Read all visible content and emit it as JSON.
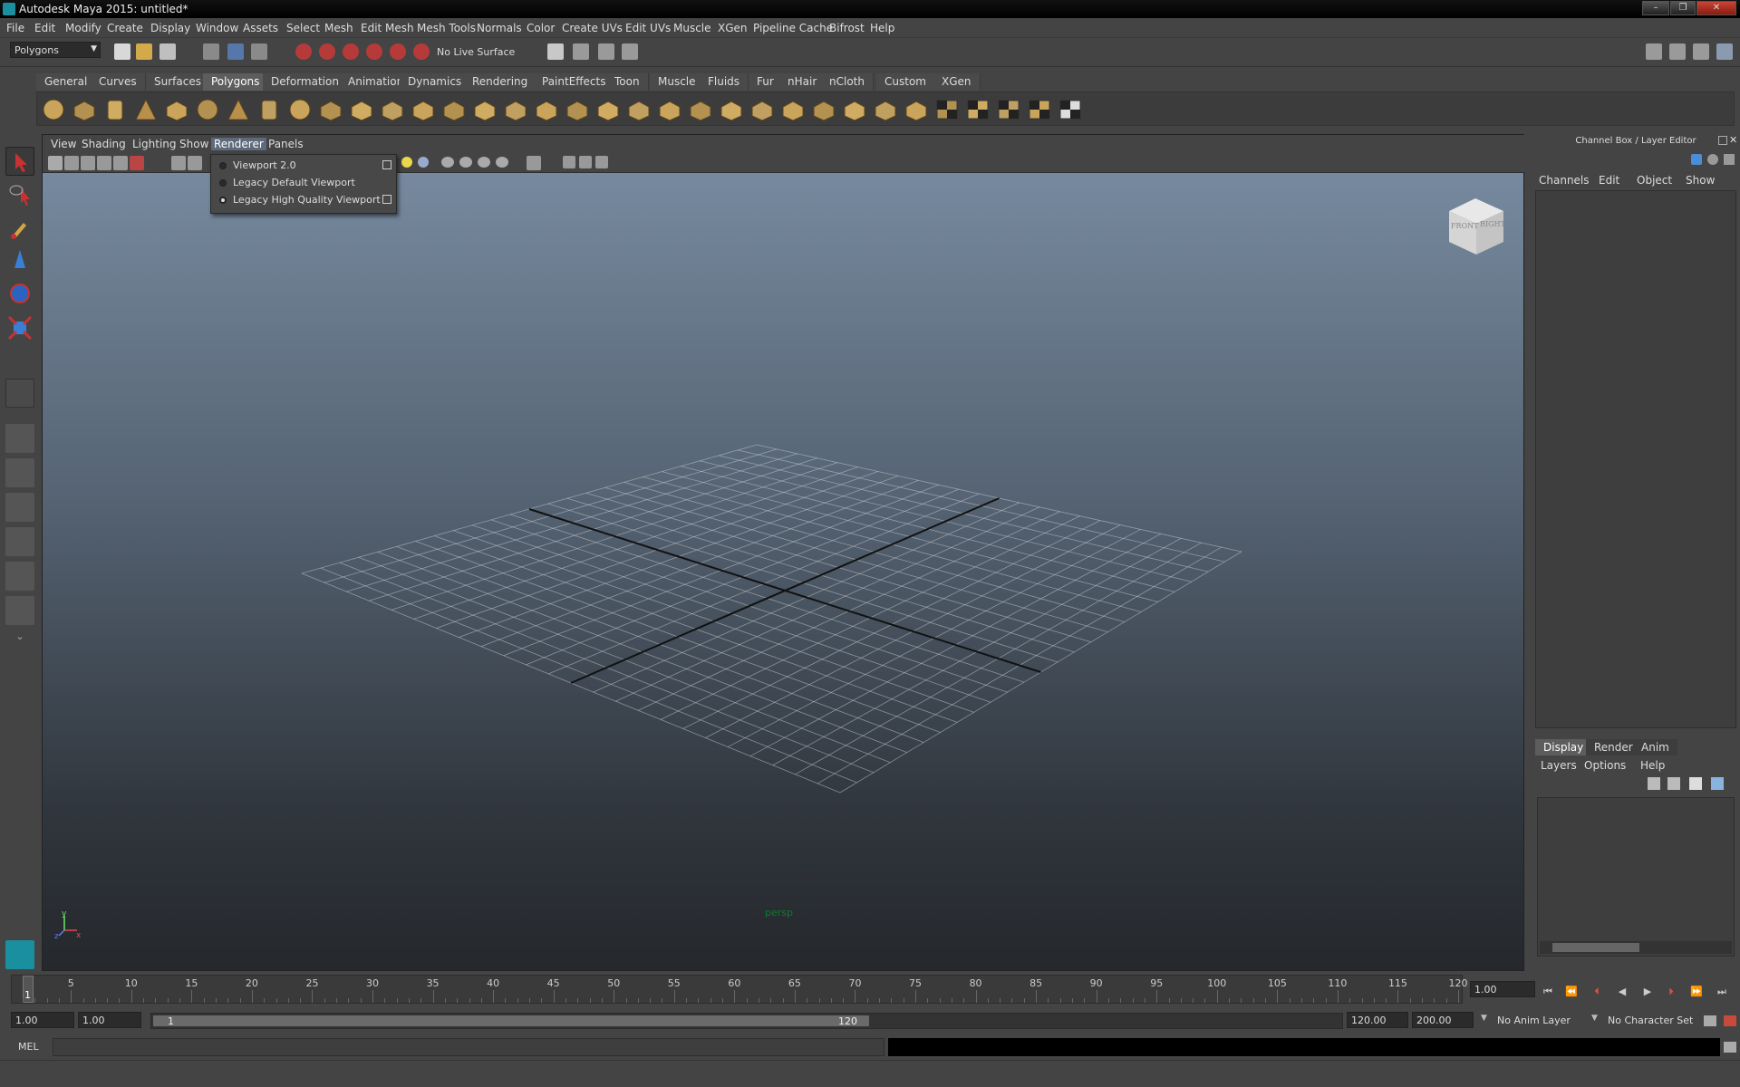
{
  "window": {
    "title": "Autodesk Maya 2015: untitled*",
    "controls": [
      "–",
      "❐",
      "✕"
    ]
  },
  "menubar": [
    "File",
    "Edit",
    "Modify",
    "Create",
    "Display",
    "Window",
    "Assets",
    "Select",
    "Mesh",
    "Edit Mesh",
    "Mesh Tools",
    "Normals",
    "Color",
    "Create UVs",
    "Edit UVs",
    "Muscle",
    "XGen",
    "Pipeline Cache",
    "Bifrost",
    "Help"
  ],
  "statusline": {
    "menuset": "Polygons",
    "live_surface": "No Live Surface"
  },
  "shelf_tabs": [
    "General",
    "Curves",
    "Surfaces",
    "Polygons",
    "Deformation",
    "Animation",
    "Dynamics",
    "Rendering",
    "PaintEffects",
    "Toon",
    "Muscle",
    "Fluids",
    "Fur",
    "nHair",
    "nCloth",
    "Custom",
    "XGen"
  ],
  "shelf_active_tab": "Polygons",
  "viewport": {
    "menus": [
      "View",
      "Shading",
      "Lighting",
      "Show",
      "Renderer",
      "Panels"
    ],
    "open_menu": "Renderer",
    "camera_label": "persp",
    "viewcube": {
      "front": "FRONT",
      "right": "RIGHT"
    },
    "renderer_menu": [
      {
        "label": "Viewport 2.0",
        "selected": false,
        "has_options": true
      },
      {
        "label": "Legacy Default Viewport",
        "selected": false,
        "has_options": false
      },
      {
        "label": "Legacy High Quality Viewport",
        "selected": true,
        "has_options": true
      }
    ]
  },
  "channel_box": {
    "title": "Channel Box / Layer Editor",
    "menus": [
      "Channels",
      "Edit",
      "Object",
      "Show"
    ]
  },
  "layer_editor": {
    "tabs": [
      "Display",
      "Render",
      "Anim"
    ],
    "active_tab": "Display",
    "menus": [
      "Layers",
      "Options",
      "Help"
    ]
  },
  "timeline": {
    "start": 1,
    "end": 120,
    "tick_labels": [
      "5",
      "10",
      "15",
      "20",
      "25",
      "30",
      "35",
      "40",
      "45",
      "50",
      "55",
      "60",
      "65",
      "70",
      "75",
      "80",
      "85",
      "90",
      "95",
      "100",
      "105",
      "110",
      "115",
      "120"
    ],
    "current_frame_label": "1",
    "current_time": "1.00"
  },
  "range": {
    "start_time": "1.00",
    "playback_start": "1.00",
    "range_start_label": "1",
    "range_end_label": "120",
    "playback_end": "120.00",
    "end_time": "200.00",
    "anim_layer": "No Anim Layer",
    "character_set": "No Character Set"
  },
  "command_line": {
    "label": "MEL"
  },
  "colors": {
    "accent": "#5d6a7a",
    "grid": "#c8cdd3",
    "axis": "#111111"
  }
}
